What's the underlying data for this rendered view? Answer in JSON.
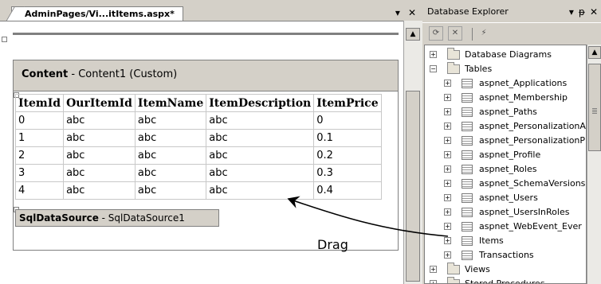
{
  "editor": {
    "tab_title": "AdminPages/Vi...itItems.aspx*",
    "tab_menu_glyph": "▾",
    "tab_close_glyph": "✕",
    "content_title_bold": "Content",
    "content_title_rest": " - Content1 (Custom)",
    "grid": {
      "columns": [
        "ItemId",
        "OurItemId",
        "ItemName",
        "ItemDescription",
        "ItemPrice"
      ],
      "rows": [
        [
          "0",
          "abc",
          "abc",
          "abc",
          "0"
        ],
        [
          "1",
          "abc",
          "abc",
          "abc",
          "0.1"
        ],
        [
          "2",
          "abc",
          "abc",
          "abc",
          "0.2"
        ],
        [
          "3",
          "abc",
          "abc",
          "abc",
          "0.3"
        ],
        [
          "4",
          "abc",
          "abc",
          "abc",
          "0.4"
        ]
      ]
    },
    "sqldatasource_bold": "SqlDataSource",
    "sqldatasource_rest": " - SqlDataSource1",
    "drag_label": "Drag"
  },
  "database_explorer": {
    "title": "Database Explorer",
    "ctrl_menu": "▾",
    "ctrl_pin": "ᵽ",
    "ctrl_close": "✕",
    "tree": [
      {
        "label": "Database Diagrams",
        "kind": "folder",
        "level": 0,
        "expander": "+"
      },
      {
        "label": "Tables",
        "kind": "folder",
        "level": 0,
        "expander": "−"
      },
      {
        "label": "aspnet_Applications",
        "kind": "table",
        "level": 1,
        "expander": "+"
      },
      {
        "label": "aspnet_Membership",
        "kind": "table",
        "level": 1,
        "expander": "+"
      },
      {
        "label": "aspnet_Paths",
        "kind": "table",
        "level": 1,
        "expander": "+"
      },
      {
        "label": "aspnet_PersonalizationA",
        "kind": "table",
        "level": 1,
        "expander": "+"
      },
      {
        "label": "aspnet_PersonalizationP",
        "kind": "table",
        "level": 1,
        "expander": "+"
      },
      {
        "label": "aspnet_Profile",
        "kind": "table",
        "level": 1,
        "expander": "+"
      },
      {
        "label": "aspnet_Roles",
        "kind": "table",
        "level": 1,
        "expander": "+"
      },
      {
        "label": "aspnet_SchemaVersions",
        "kind": "table",
        "level": 1,
        "expander": "+"
      },
      {
        "label": "aspnet_Users",
        "kind": "table",
        "level": 1,
        "expander": "+"
      },
      {
        "label": "aspnet_UsersInRoles",
        "kind": "table",
        "level": 1,
        "expander": "+"
      },
      {
        "label": "aspnet_WebEvent_Ever",
        "kind": "table",
        "level": 1,
        "expander": "+"
      },
      {
        "label": "Items",
        "kind": "table",
        "level": 1,
        "expander": "+"
      },
      {
        "label": "Transactions",
        "kind": "table",
        "level": 1,
        "expander": "+"
      },
      {
        "label": "Views",
        "kind": "folder",
        "level": 0,
        "expander": "+"
      },
      {
        "label": "Stored Procedures",
        "kind": "folder",
        "level": 0,
        "expander": "+"
      }
    ]
  },
  "icons": {
    "refresh": "refresh-icon",
    "stop": "stop-icon",
    "connect": "connect-to-database-icon"
  }
}
